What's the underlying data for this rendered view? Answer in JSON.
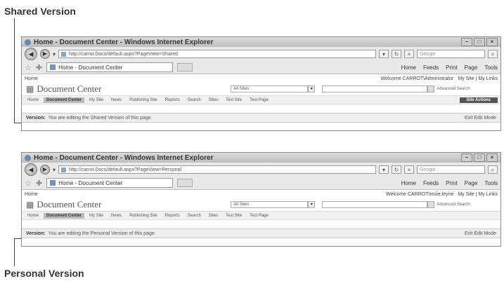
{
  "captions": {
    "top": "Shared Version",
    "bottom": "Personal Version"
  },
  "windows": [
    {
      "title": "Home - Document Center - Windows Internet Explorer",
      "address": "http://carrot.Docs/default.aspx?PageView=Shared",
      "search_placeholder": "Google",
      "tab_label": "Home - Document Center",
      "toolbar": [
        "Home",
        "Feeds",
        "Print",
        "Page",
        "Tools"
      ],
      "breadcrumb": "Home",
      "welcome": "Welcome CARROT\\Administrator",
      "links": "My Site | My Links",
      "logo": "Document Center",
      "scope": "All Sites",
      "advanced": "Advanced Search",
      "nav": [
        "Home",
        "Document Center",
        "My Site",
        "News",
        "Publishing Site",
        "Reports",
        "Search",
        "Sites",
        "Test Site",
        "Test Page"
      ],
      "site_actions": "Site Actions",
      "status_label": "Version:",
      "status_text": "You are editing the Shared Version of this page",
      "exit": "Exit Edit Mode"
    },
    {
      "title": "Home - Document Center - Windows Internet Explorer",
      "address": "http://carrot.Docs/default.aspx?PageView=Personal",
      "search_placeholder": "Google",
      "tab_label": "Home - Document Center",
      "toolbar": [
        "Home",
        "Feeds",
        "Print",
        "Page",
        "Tools"
      ],
      "breadcrumb": "Home",
      "welcome": "Welcome CARROT\\rosie.leyne",
      "links": "My Site | My Links",
      "logo": "Document Center",
      "scope": "All Sites",
      "advanced": "Advanced Search",
      "nav": [
        "Home",
        "Document Center",
        "My Site",
        "News",
        "Publishing Site",
        "Reports",
        "Search",
        "Sites",
        "Test Site",
        "Test Page"
      ],
      "site_actions": "",
      "status_label": "Version:",
      "status_text": "You are editing the Personal Version of this page",
      "exit": "Exit Edit Mode"
    }
  ]
}
